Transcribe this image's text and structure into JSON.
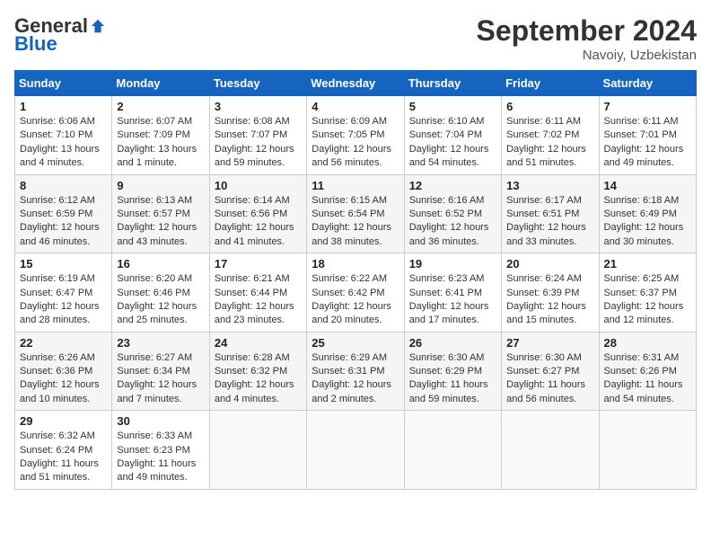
{
  "header": {
    "logo_general": "General",
    "logo_blue": "Blue",
    "month_title": "September 2024",
    "location": "Navoiy, Uzbekistan"
  },
  "days_of_week": [
    "Sunday",
    "Monday",
    "Tuesday",
    "Wednesday",
    "Thursday",
    "Friday",
    "Saturday"
  ],
  "weeks": [
    [
      {
        "day": "1",
        "sunrise": "6:06 AM",
        "sunset": "7:10 PM",
        "daylight": "13 hours and 4 minutes."
      },
      {
        "day": "2",
        "sunrise": "6:07 AM",
        "sunset": "7:09 PM",
        "daylight": "13 hours and 1 minute."
      },
      {
        "day": "3",
        "sunrise": "6:08 AM",
        "sunset": "7:07 PM",
        "daylight": "12 hours and 59 minutes."
      },
      {
        "day": "4",
        "sunrise": "6:09 AM",
        "sunset": "7:05 PM",
        "daylight": "12 hours and 56 minutes."
      },
      {
        "day": "5",
        "sunrise": "6:10 AM",
        "sunset": "7:04 PM",
        "daylight": "12 hours and 54 minutes."
      },
      {
        "day": "6",
        "sunrise": "6:11 AM",
        "sunset": "7:02 PM",
        "daylight": "12 hours and 51 minutes."
      },
      {
        "day": "7",
        "sunrise": "6:11 AM",
        "sunset": "7:01 PM",
        "daylight": "12 hours and 49 minutes."
      }
    ],
    [
      {
        "day": "8",
        "sunrise": "6:12 AM",
        "sunset": "6:59 PM",
        "daylight": "12 hours and 46 minutes."
      },
      {
        "day": "9",
        "sunrise": "6:13 AM",
        "sunset": "6:57 PM",
        "daylight": "12 hours and 43 minutes."
      },
      {
        "day": "10",
        "sunrise": "6:14 AM",
        "sunset": "6:56 PM",
        "daylight": "12 hours and 41 minutes."
      },
      {
        "day": "11",
        "sunrise": "6:15 AM",
        "sunset": "6:54 PM",
        "daylight": "12 hours and 38 minutes."
      },
      {
        "day": "12",
        "sunrise": "6:16 AM",
        "sunset": "6:52 PM",
        "daylight": "12 hours and 36 minutes."
      },
      {
        "day": "13",
        "sunrise": "6:17 AM",
        "sunset": "6:51 PM",
        "daylight": "12 hours and 33 minutes."
      },
      {
        "day": "14",
        "sunrise": "6:18 AM",
        "sunset": "6:49 PM",
        "daylight": "12 hours and 30 minutes."
      }
    ],
    [
      {
        "day": "15",
        "sunrise": "6:19 AM",
        "sunset": "6:47 PM",
        "daylight": "12 hours and 28 minutes."
      },
      {
        "day": "16",
        "sunrise": "6:20 AM",
        "sunset": "6:46 PM",
        "daylight": "12 hours and 25 minutes."
      },
      {
        "day": "17",
        "sunrise": "6:21 AM",
        "sunset": "6:44 PM",
        "daylight": "12 hours and 23 minutes."
      },
      {
        "day": "18",
        "sunrise": "6:22 AM",
        "sunset": "6:42 PM",
        "daylight": "12 hours and 20 minutes."
      },
      {
        "day": "19",
        "sunrise": "6:23 AM",
        "sunset": "6:41 PM",
        "daylight": "12 hours and 17 minutes."
      },
      {
        "day": "20",
        "sunrise": "6:24 AM",
        "sunset": "6:39 PM",
        "daylight": "12 hours and 15 minutes."
      },
      {
        "day": "21",
        "sunrise": "6:25 AM",
        "sunset": "6:37 PM",
        "daylight": "12 hours and 12 minutes."
      }
    ],
    [
      {
        "day": "22",
        "sunrise": "6:26 AM",
        "sunset": "6:36 PM",
        "daylight": "12 hours and 10 minutes."
      },
      {
        "day": "23",
        "sunrise": "6:27 AM",
        "sunset": "6:34 PM",
        "daylight": "12 hours and 7 minutes."
      },
      {
        "day": "24",
        "sunrise": "6:28 AM",
        "sunset": "6:32 PM",
        "daylight": "12 hours and 4 minutes."
      },
      {
        "day": "25",
        "sunrise": "6:29 AM",
        "sunset": "6:31 PM",
        "daylight": "12 hours and 2 minutes."
      },
      {
        "day": "26",
        "sunrise": "6:30 AM",
        "sunset": "6:29 PM",
        "daylight": "11 hours and 59 minutes."
      },
      {
        "day": "27",
        "sunrise": "6:30 AM",
        "sunset": "6:27 PM",
        "daylight": "11 hours and 56 minutes."
      },
      {
        "day": "28",
        "sunrise": "6:31 AM",
        "sunset": "6:26 PM",
        "daylight": "11 hours and 54 minutes."
      }
    ],
    [
      {
        "day": "29",
        "sunrise": "6:32 AM",
        "sunset": "6:24 PM",
        "daylight": "11 hours and 51 minutes."
      },
      {
        "day": "30",
        "sunrise": "6:33 AM",
        "sunset": "6:23 PM",
        "daylight": "11 hours and 49 minutes."
      },
      null,
      null,
      null,
      null,
      null
    ]
  ],
  "labels": {
    "sunrise": "Sunrise:",
    "sunset": "Sunset:",
    "daylight": "Daylight:"
  }
}
